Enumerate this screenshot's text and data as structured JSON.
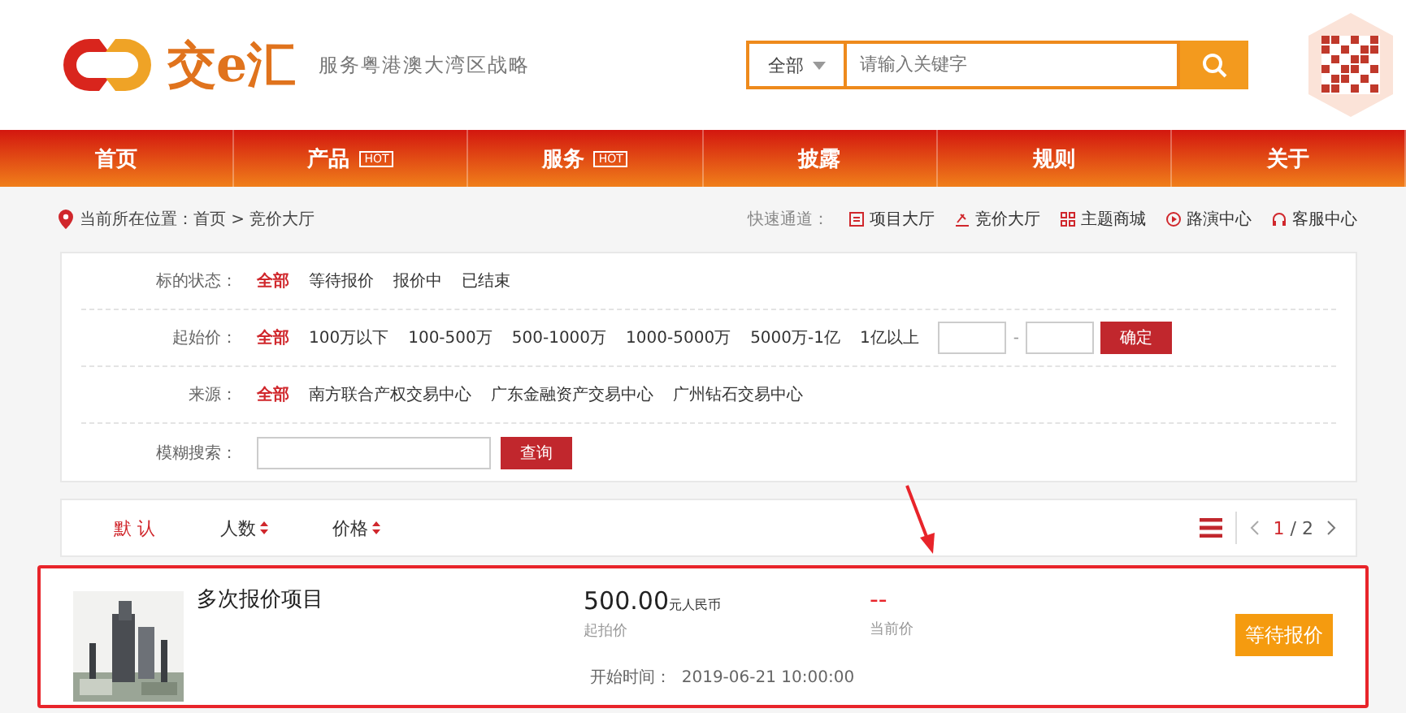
{
  "header": {
    "logo_text": "交e汇",
    "tagline": "服务粤港澳大湾区战略",
    "search": {
      "scope": "全部",
      "placeholder": "请输入关键字"
    }
  },
  "nav": [
    {
      "label": "首页",
      "hot": false
    },
    {
      "label": "产品",
      "hot": true,
      "badge": "HOT"
    },
    {
      "label": "服务",
      "hot": true,
      "badge": "HOT"
    },
    {
      "label": "披露",
      "hot": false
    },
    {
      "label": "规则",
      "hot": false
    },
    {
      "label": "关于",
      "hot": false
    }
  ],
  "breadcrumb": {
    "prefix": "当前所在位置：",
    "path": "首页 > 竞价大厅"
  },
  "quick_links": {
    "label": "快速通道：",
    "items": [
      {
        "kind": "doc",
        "label": "项目大厅"
      },
      {
        "kind": "auction",
        "label": "竞价大厅"
      },
      {
        "kind": "grid",
        "label": "主题商城"
      },
      {
        "kind": "play",
        "label": "路演中心"
      },
      {
        "kind": "headset",
        "label": "客服中心"
      }
    ]
  },
  "filters": [
    {
      "kind": "options",
      "label": "标的状态：",
      "options": [
        {
          "label": "全部",
          "selected": true
        },
        {
          "label": "等待报价",
          "selected": false
        },
        {
          "label": "报价中",
          "selected": false
        },
        {
          "label": "已结束",
          "selected": false
        }
      ]
    },
    {
      "kind": "range",
      "label": "起始价：",
      "options": [
        {
          "label": "全部",
          "selected": true
        },
        {
          "label": "100万以下",
          "selected": false
        },
        {
          "label": "100-500万",
          "selected": false
        },
        {
          "label": "500-1000万",
          "selected": false
        },
        {
          "label": "1000-5000万",
          "selected": false
        },
        {
          "label": "5000万-1亿",
          "selected": false
        },
        {
          "label": "1亿以上",
          "selected": false
        }
      ],
      "separator": "-",
      "button": "确定"
    },
    {
      "kind": "options",
      "label": "来源：",
      "options": [
        {
          "label": "全部",
          "selected": true
        },
        {
          "label": "南方联合产权交易中心",
          "selected": false
        },
        {
          "label": "广东金融资产交易中心",
          "selected": false
        },
        {
          "label": "广州钻石交易中心",
          "selected": false
        }
      ]
    },
    {
      "kind": "search",
      "label": "模糊搜索：",
      "button": "查询"
    }
  ],
  "sort": {
    "items": [
      {
        "label": "默 认",
        "selected": true,
        "arrows": false
      },
      {
        "label": "人数",
        "selected": false,
        "arrows": true
      },
      {
        "label": "价格",
        "selected": false,
        "arrows": true
      }
    ],
    "page": {
      "current": "1",
      "total": "/ 2"
    }
  },
  "items": [
    {
      "title": "多次报价项目",
      "start_price": "500.00",
      "unit": "元人民币",
      "start_label": "起拍价",
      "current_price": "--",
      "current_label": "当前价",
      "time_label": "开始时间：",
      "time": "2019-06-21 10:00:00",
      "status": "等待报价",
      "highlighted": true
    }
  ]
}
